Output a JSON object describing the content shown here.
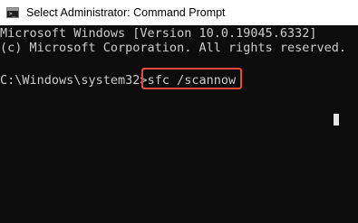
{
  "window": {
    "title": "Select Administrator: Command Prompt",
    "icon": "cmd-icon",
    "icon_glyph": ">_"
  },
  "console": {
    "lines": [
      "Microsoft Windows [Version 10.0.19045.6332]",
      "(c) Microsoft Corporation. All rights reserved."
    ],
    "prompt": "C:\\Windows\\system32>",
    "command": "sfc /scannow"
  },
  "colors": {
    "background": "#0c0c0c",
    "text": "#cccccc",
    "highlight": "#e8473c",
    "titlebar": "#ffffff"
  }
}
